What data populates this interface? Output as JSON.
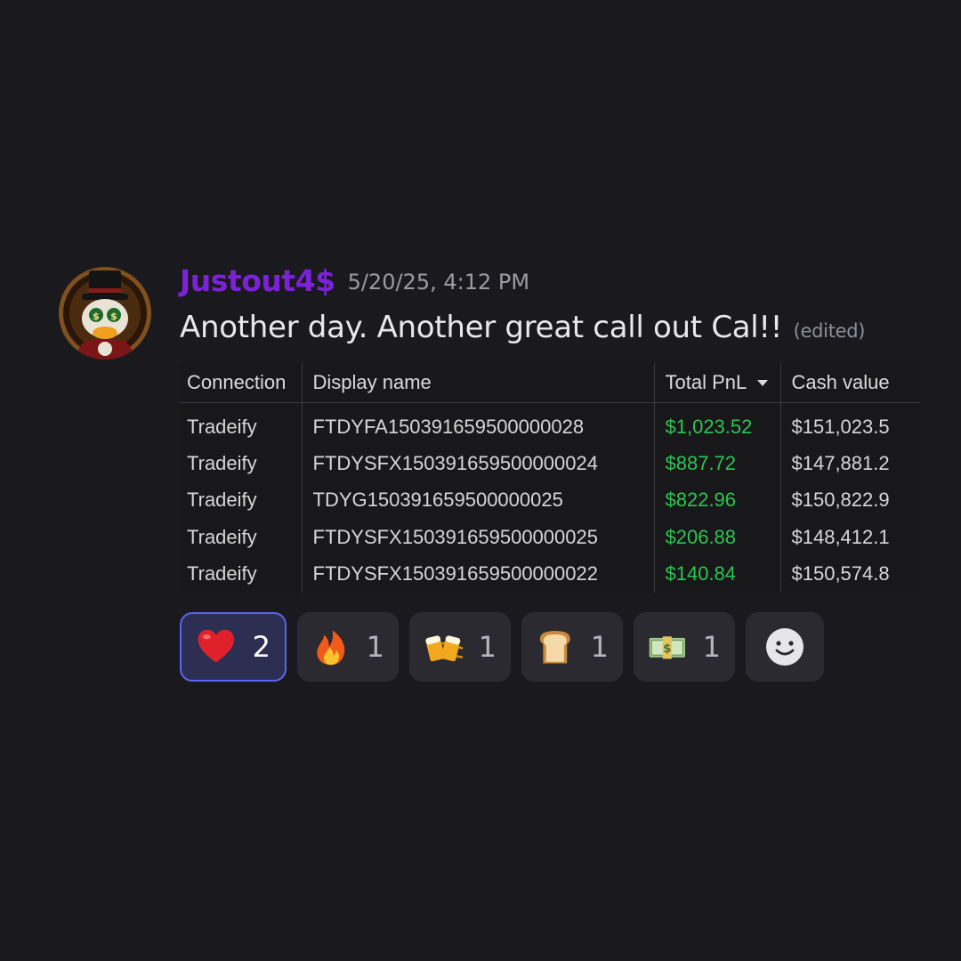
{
  "message": {
    "author": "Justout4$",
    "timestamp": "5/20/25, 4:12 PM",
    "text": "Another day. Another great call out Cal!!",
    "edited_label": "(edited)",
    "avatar_icon": "scrooge-duck-avatar"
  },
  "attachment_table": {
    "columns": [
      "Connection",
      "Display name",
      "Total PnL",
      "Cash value"
    ],
    "sorted_column": "Total PnL",
    "rows": [
      [
        "Tradeify",
        "FTDYFA150391659500000028",
        "$1,023.52",
        "$151,023.5"
      ],
      [
        "Tradeify",
        "FTDYSFX150391659500000024",
        "$887.72",
        "$147,881.2"
      ],
      [
        "Tradeify",
        "TDYG150391659500000025",
        "$822.96",
        "$150,822.9"
      ],
      [
        "Tradeify",
        "FTDYSFX150391659500000025",
        "$206.88",
        "$148,412.1"
      ],
      [
        "Tradeify",
        "FTDYSFX150391659500000022",
        "$140.84",
        "$150,574.8"
      ]
    ],
    "colors": {
      "positive": "#2ec452",
      "text": "#d6d6d6",
      "background": "#18181a"
    }
  },
  "reactions": [
    {
      "emoji": "heart-icon",
      "count": "2",
      "active": true
    },
    {
      "emoji": "fire-icon",
      "count": "1",
      "active": false
    },
    {
      "emoji": "beer-mugs-icon",
      "count": "1",
      "active": false
    },
    {
      "emoji": "bread-icon",
      "count": "1",
      "active": false
    },
    {
      "emoji": "money-icon",
      "count": "1",
      "active": false
    }
  ],
  "add_reaction_icon": "add-reaction-smiley-icon",
  "colors": {
    "background": "#1a1a1e",
    "username": "#7b22d6",
    "reaction_active_border": "#5865f2",
    "reaction_bg": "#2a2a30"
  }
}
